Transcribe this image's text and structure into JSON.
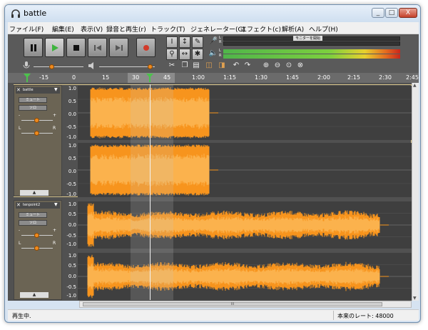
{
  "window": {
    "title": "battle",
    "minimize_label": "_",
    "restore_label": "□",
    "close_label": "X"
  },
  "menubar": {
    "items": [
      "ファイル(F)",
      "編集(E)",
      "表示(V)",
      "録音と再生(r)",
      "トラック(T)",
      "ジェネレーター(G)",
      "エフェクト(c)",
      "解析(A)",
      "ヘルプ(H)"
    ]
  },
  "meters": {
    "play_labels": [
      "L",
      "R"
    ],
    "rec_labels": [
      "L",
      "R"
    ],
    "hint_text": "モニターを開始"
  },
  "timeline": {
    "ticks": [
      "-15",
      "0",
      "15",
      "30",
      "45",
      "1:00",
      "1:15",
      "1:30",
      "1:45",
      "2:00",
      "2:15",
      "2:30",
      "2:45"
    ]
  },
  "tracks": [
    {
      "name": "battle",
      "mute_label": "ミュート",
      "solo_label": "ソロ",
      "pan_left": "L",
      "pan_right": "R",
      "gain_minus": "-",
      "gain_plus": "+",
      "axis": [
        "1.0",
        "0.5",
        "0.0",
        "-0.5",
        "-1.0"
      ]
    },
    {
      "name": "tenpoint2",
      "mute_label": "ミュート",
      "solo_label": "ソロ",
      "pan_left": "L",
      "pan_right": "R",
      "gain_minus": "-",
      "gain_plus": "+",
      "axis": [
        "1.0",
        "0.5",
        "0.0",
        "-0.5",
        "-1.0"
      ]
    }
  ],
  "hscroll": {
    "grip": "III"
  },
  "status": {
    "left": "再生中.",
    "right": "本来のレート: 48000"
  },
  "colors": {
    "wave_orange": "#f7941d",
    "wave_light": "#fbb24d",
    "selection": "#8a8a8a",
    "play_green": "#3db43d",
    "record_red": "#d23b2a"
  },
  "icons": {
    "play": "play-icon",
    "pause": "pause-icon",
    "stop": "stop-icon",
    "skip_start": "skip-start-icon",
    "skip_end": "skip-end-icon",
    "record": "record-icon"
  }
}
